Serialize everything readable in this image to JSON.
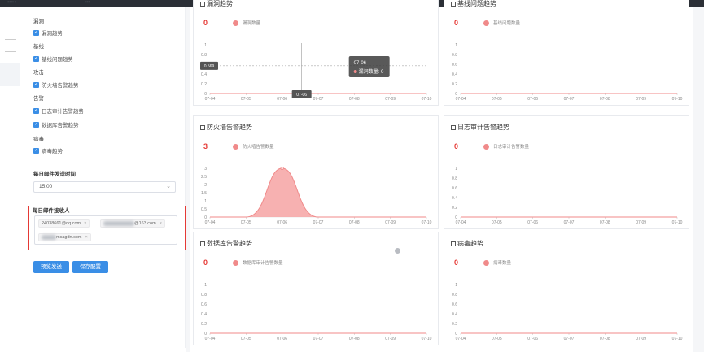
{
  "settings": {
    "groups": [
      {
        "heading": "漏洞",
        "items": [
          "漏洞趋势"
        ]
      },
      {
        "heading": "基线",
        "items": [
          "基线问题趋势"
        ]
      },
      {
        "heading": "攻击",
        "items": [
          "防火墙告警趋势"
        ]
      },
      {
        "heading": "告警",
        "items": [
          "日志审计告警趋势",
          "数据库告警趋势"
        ]
      },
      {
        "heading": "病毒",
        "items": [
          "病毒趋势"
        ]
      }
    ],
    "send_time_label": "每日邮件发送时间",
    "send_time_value": "15:00",
    "recipients_label": "每日邮件接收人",
    "recipients": [
      "24038661@qq.com",
      "@163.com",
      "mcagdn.com"
    ],
    "preview_button": "预览发送",
    "save_button": "保存配置"
  },
  "colors": {
    "accent": "#3a8ee6",
    "series": "#f08a8a",
    "count": "#e53935"
  },
  "panels": [
    {
      "id": "vuln",
      "title": "漏洞趋势",
      "count": "0",
      "legend": "漏洞数量"
    },
    {
      "id": "baseline",
      "title": "基线问题趋势",
      "count": "0",
      "legend": "基线问题数量"
    },
    {
      "id": "firewall",
      "title": "防火墙告警趋势",
      "count": "3",
      "legend": "防火墙告警数量"
    },
    {
      "id": "logaudit",
      "title": "日志审计告警趋势",
      "count": "0",
      "legend": "日志审计告警数量"
    },
    {
      "id": "database",
      "title": "数据库告警趋势",
      "count": "0",
      "legend": "数据库审计告警数量"
    },
    {
      "id": "virus",
      "title": "病毒趋势",
      "count": "0",
      "legend": "病毒数量"
    }
  ],
  "tooltip": {
    "date": "07-06",
    "label": "漏洞数量: 0",
    "cursor_value": "0.569",
    "cursor_date": "07-06"
  },
  "chart_data": [
    {
      "type": "line",
      "x": [
        "07-04",
        "07-05",
        "07-06",
        "07-07",
        "07-08",
        "07-09",
        "07-10"
      ],
      "ylim": [
        0,
        1
      ],
      "yticks": [
        0,
        0.2,
        0.4,
        0.6,
        0.8,
        1
      ],
      "series": [
        {
          "name": "漏洞数量",
          "values": [
            0,
            0,
            0,
            0,
            0,
            0,
            0
          ]
        }
      ]
    },
    {
      "type": "line",
      "x": [
        "07-04",
        "07-05",
        "07-06",
        "07-07",
        "07-08",
        "07-09",
        "07-10"
      ],
      "ylim": [
        0,
        1
      ],
      "yticks": [
        0,
        0.2,
        0.4,
        0.6,
        0.8,
        1
      ],
      "series": [
        {
          "name": "基线问题数量",
          "values": [
            0,
            0,
            0,
            0,
            0,
            0,
            0
          ]
        }
      ]
    },
    {
      "type": "area",
      "x": [
        "07-04",
        "07-05",
        "07-06",
        "07-07",
        "07-08",
        "07-09",
        "07-10"
      ],
      "ylim": [
        0,
        3
      ],
      "yticks": [
        0,
        0.5,
        1,
        1.5,
        2,
        2.5,
        3
      ],
      "series": [
        {
          "name": "防火墙告警数量",
          "values": [
            0,
            0,
            3,
            0,
            0,
            0,
            0
          ]
        }
      ]
    },
    {
      "type": "line",
      "x": [
        "07-04",
        "07-05",
        "07-06",
        "07-07",
        "07-08",
        "07-09",
        "07-10"
      ],
      "ylim": [
        0,
        1
      ],
      "yticks": [
        0,
        0.2,
        0.4,
        0.6,
        0.8,
        1
      ],
      "series": [
        {
          "name": "日志审计告警数量",
          "values": [
            0,
            0,
            0,
            0,
            0,
            0,
            0
          ]
        }
      ]
    },
    {
      "type": "line",
      "x": [
        "07-04",
        "07-05",
        "07-06",
        "07-07",
        "07-08",
        "07-09",
        "07-10"
      ],
      "ylim": [
        0,
        1
      ],
      "yticks": [
        0,
        0.2,
        0.4,
        0.6,
        0.8,
        1
      ],
      "series": [
        {
          "name": "数据库审计告警数量",
          "values": [
            0,
            0,
            0,
            0,
            0,
            0,
            0
          ]
        }
      ]
    },
    {
      "type": "line",
      "x": [
        "07-04",
        "07-05",
        "07-06",
        "07-07",
        "07-08",
        "07-09",
        "07-10"
      ],
      "ylim": [
        0,
        1
      ],
      "yticks": [
        0,
        0.2,
        0.4,
        0.6,
        0.8,
        1
      ],
      "series": [
        {
          "name": "病毒数量",
          "values": [
            0,
            0,
            0,
            0,
            0,
            0,
            0
          ]
        }
      ]
    }
  ]
}
